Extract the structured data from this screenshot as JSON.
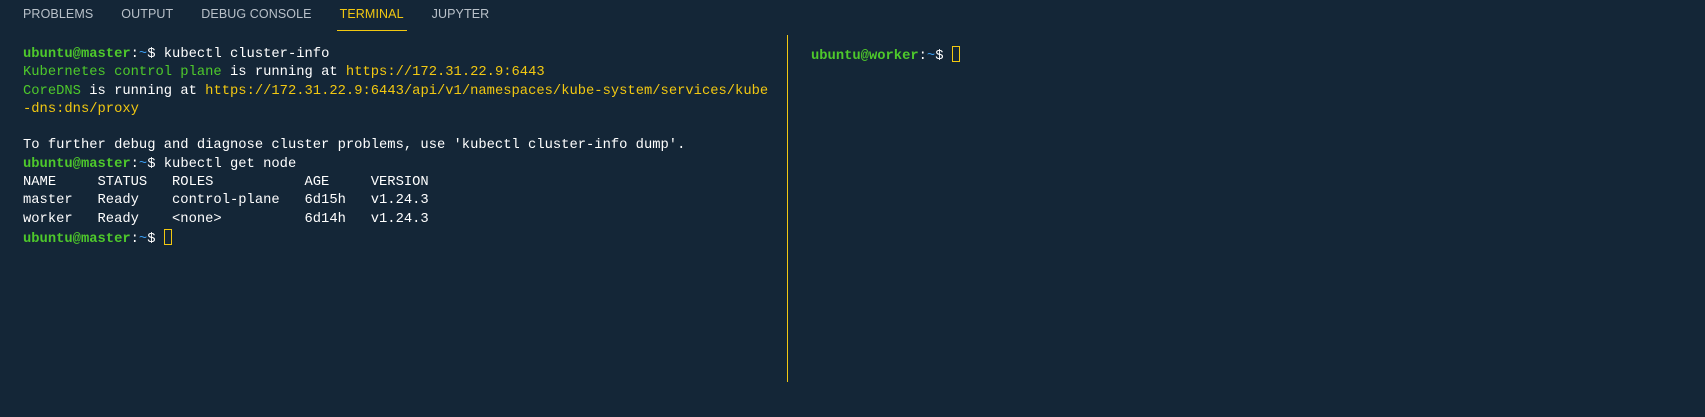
{
  "panel": {
    "tabs": [
      {
        "label": "PROBLEMS",
        "active": false
      },
      {
        "label": "OUTPUT",
        "active": false
      },
      {
        "label": "DEBUG CONSOLE",
        "active": false
      },
      {
        "label": "TERMINAL",
        "active": true
      },
      {
        "label": "JUPYTER",
        "active": false
      }
    ]
  },
  "colors": {
    "background": "#142637",
    "accent": "#f2c811",
    "prompt": "#4ec92b",
    "path": "#3b9cf0"
  },
  "left_terminal": {
    "user_host": "ubuntu@master",
    "path": "~",
    "cmd1": "kubectl cluster-info",
    "line1_a": "Kubernetes control plane",
    "line1_b": " is running at ",
    "line1_url": "https://172.31.22.9:6443",
    "line2_a": "CoreDNS",
    "line2_b": " is running at ",
    "line2_url": "https://172.31.22.9:6443/api/v1/namespaces/kube-system/services/kube",
    "line2_url_cont": "-dns:dns/proxy",
    "debug_msg": "To further debug and diagnose cluster problems, use 'kubectl cluster-info dump'.",
    "cmd2": "kubectl get node",
    "table_header": "NAME     STATUS   ROLES           AGE     VERSION",
    "rows": [
      "master   Ready    control-plane   6d15h   v1.24.3",
      "worker   Ready    <none>          6d14h   v1.24.3"
    ]
  },
  "right_terminal": {
    "user_host": "ubuntu@worker",
    "path": "~"
  }
}
